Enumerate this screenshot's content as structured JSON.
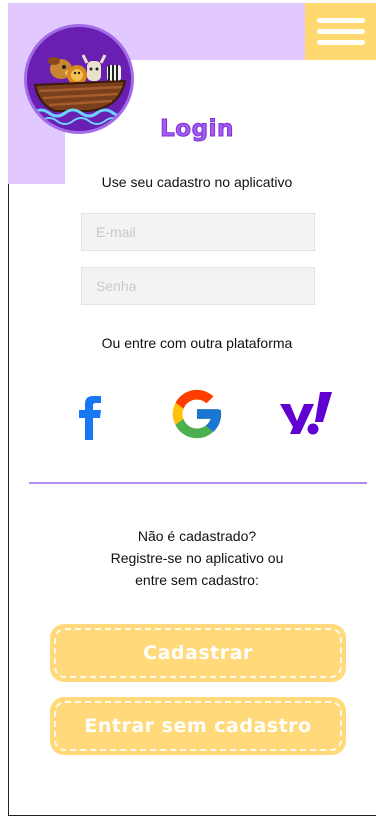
{
  "header": {
    "menu_icon": "hamburger-icon",
    "logo_icon": "ark-animals-logo"
  },
  "login": {
    "title": "Login",
    "subtitle": "Use seu cadastro no aplicativo",
    "email_placeholder": "E-mail",
    "password_placeholder": "Senha"
  },
  "social": {
    "heading": "Ou entre com outra plataforma",
    "providers": [
      {
        "icon": "facebook-icon",
        "color": "#1877f2"
      },
      {
        "icon": "google-icon",
        "color": "#4285f4"
      },
      {
        "icon": "yahoo-icon",
        "color": "#6001d2"
      }
    ]
  },
  "register": {
    "lines": [
      "Não é cadastrado?",
      "Registre-se no aplicativo ou",
      "entre sem cadastro:"
    ],
    "signup_label": "Cadastrar",
    "guest_label": "Entrar sem cadastro"
  },
  "colors": {
    "lavender": "#e1c9ff",
    "yellow": "#ffd86f",
    "purple": "#a45bf0",
    "divider": "#b28ef0"
  }
}
